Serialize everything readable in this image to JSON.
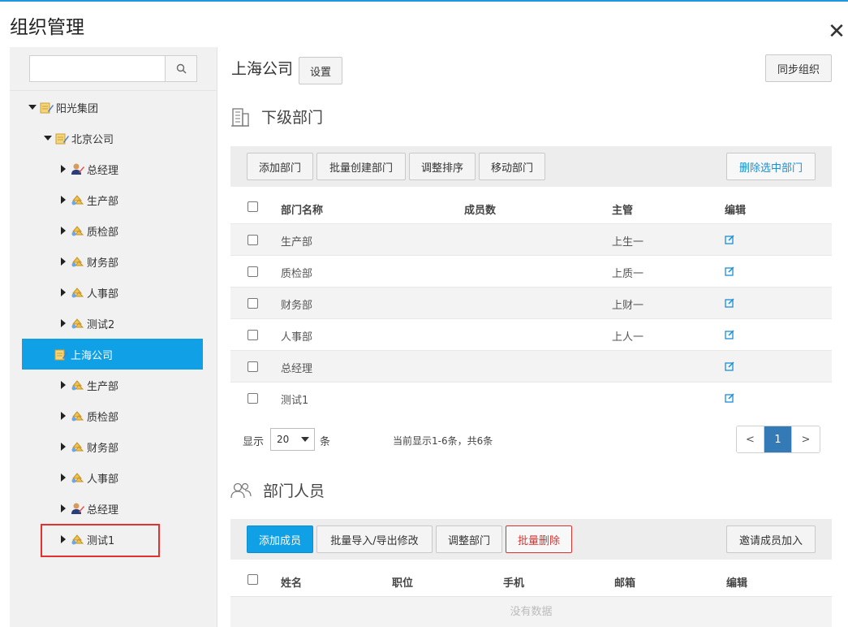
{
  "dialog": {
    "title": "组织管理",
    "close_label": "✕"
  },
  "sidebar": {
    "search_placeholder": "",
    "tree": [
      {
        "label": "阳光集团",
        "expanded": true
      },
      {
        "label": "北京公司",
        "expanded": true
      },
      {
        "label": "总经理"
      },
      {
        "label": "生产部"
      },
      {
        "label": "质检部"
      },
      {
        "label": "财务部"
      },
      {
        "label": "人事部"
      },
      {
        "label": "测试2"
      },
      {
        "label": "上海公司",
        "selected": true
      },
      {
        "label": "生产部"
      },
      {
        "label": "质检部"
      },
      {
        "label": "财务部"
      },
      {
        "label": "人事部"
      },
      {
        "label": "总经理"
      },
      {
        "label": "测试1"
      }
    ]
  },
  "main": {
    "company_name": "上海公司",
    "settings_label": "设置",
    "sync_label": "同步组织",
    "sub_dept": {
      "title": "下级部门",
      "toolbar": {
        "add": "添加部门",
        "batch_create": "批量创建部门",
        "reorder": "调整排序",
        "move": "移动部门",
        "delete_selected": "删除选中部门"
      },
      "columns": [
        "部门名称",
        "成员数",
        "主管",
        "编辑"
      ],
      "rows": [
        {
          "name": "生产部",
          "count": "",
          "manager": "上生一"
        },
        {
          "name": "质检部",
          "count": "",
          "manager": "上质一"
        },
        {
          "name": "财务部",
          "count": "",
          "manager": "上财一"
        },
        {
          "name": "人事部",
          "count": "",
          "manager": "上人一"
        },
        {
          "name": "总经理",
          "count": "",
          "manager": ""
        },
        {
          "name": "测试1",
          "count": "",
          "manager": ""
        }
      ],
      "footer": {
        "show_label": "显示",
        "page_size": "20",
        "unit_label": "条",
        "summary": "当前显示1-6条，共6条",
        "prev": "<",
        "current_page": "1",
        "next": ">"
      }
    },
    "members": {
      "title": "部门人员",
      "toolbar": {
        "add": "添加成员",
        "import_export": "批量导入/导出修改",
        "adjust_dept": "调整部门",
        "batch_delete": "批量删除",
        "invite": "邀请成员加入"
      },
      "columns": [
        "姓名",
        "职位",
        "手机",
        "邮箱",
        "编辑"
      ],
      "empty_text": "没有数据"
    }
  },
  "colors": {
    "accent": "#0fa0e6",
    "danger": "#d9322f",
    "highlight": "#e3322e"
  }
}
